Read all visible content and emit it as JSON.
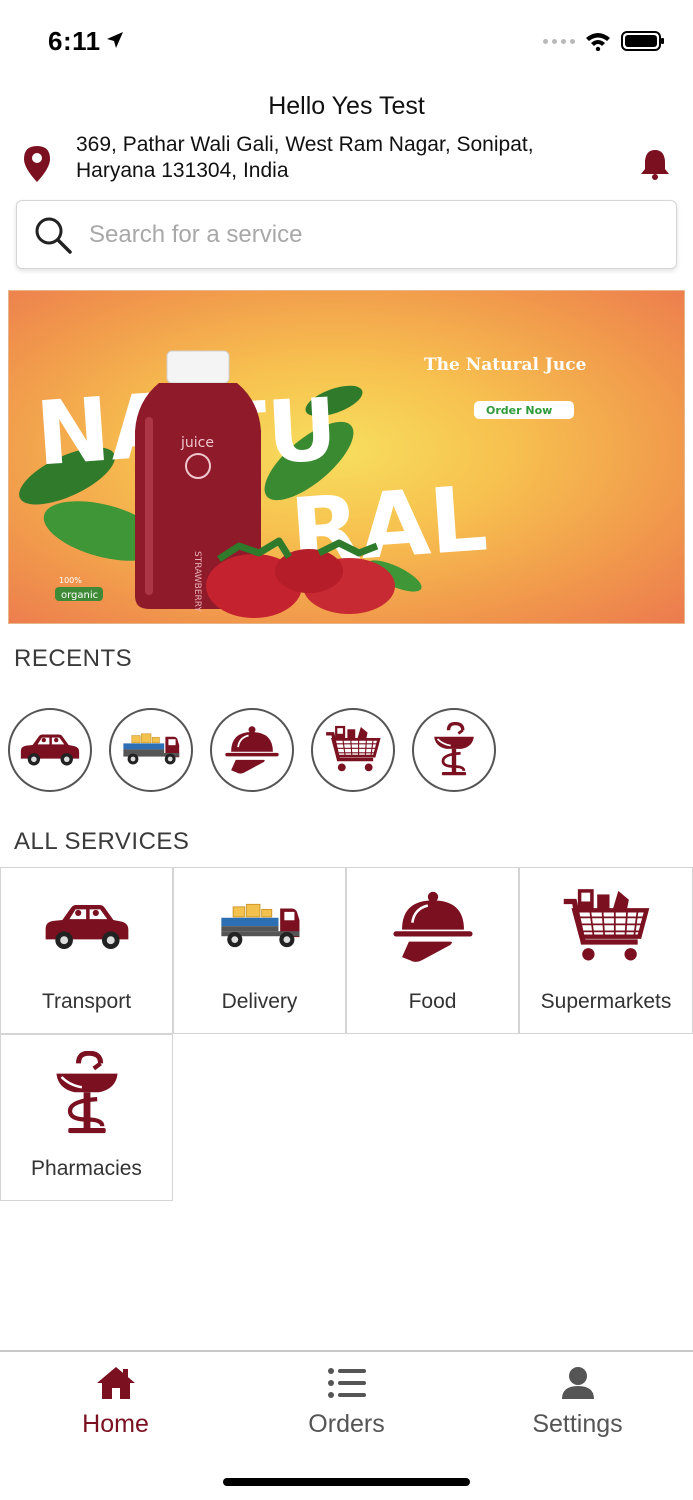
{
  "status_bar": {
    "time": "6:11"
  },
  "header": {
    "greeting": "Hello Yes Test",
    "address": "369, Pathar Wali Gali, West Ram Nagar, Sonipat, Haryana 131304, India"
  },
  "search": {
    "placeholder": "Search for a service"
  },
  "banner": {
    "word_part_1": "NA",
    "word_part_2": "TU",
    "word_part_3": "RAL",
    "headline": "The Natural Juce",
    "cta": "Order Now",
    "bottle_label": "juice",
    "bottle_flavor": "STRAWBERRY",
    "badge_top": "100%",
    "badge_bottom": "organic"
  },
  "recents": {
    "title": "RECENTS",
    "items": [
      {
        "icon": "car-icon"
      },
      {
        "icon": "delivery-truck-icon"
      },
      {
        "icon": "food-cloche-icon"
      },
      {
        "icon": "shopping-cart-icon"
      },
      {
        "icon": "pharmacy-icon"
      }
    ]
  },
  "services": {
    "title": "ALL SERVICES",
    "items": [
      {
        "label": "Transport",
        "icon": "car-icon"
      },
      {
        "label": "Delivery",
        "icon": "delivery-truck-icon"
      },
      {
        "label": "Food",
        "icon": "food-cloche-icon"
      },
      {
        "label": "Supermarkets",
        "icon": "shopping-cart-icon"
      },
      {
        "label": "Pharmacies",
        "icon": "pharmacy-icon"
      }
    ]
  },
  "tabs": [
    {
      "label": "Home",
      "icon": "home-icon",
      "active": true
    },
    {
      "label": "Orders",
      "icon": "list-icon",
      "active": false
    },
    {
      "label": "Settings",
      "icon": "user-icon",
      "active": false
    }
  ],
  "colors": {
    "brand": "#7a1020",
    "inactive": "#555555"
  }
}
